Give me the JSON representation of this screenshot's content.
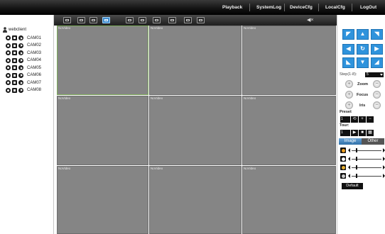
{
  "nav": {
    "items": [
      "Playback",
      "SystemLog",
      "DeviceCfg",
      "LocalCfg",
      "LogOut"
    ]
  },
  "sidebar": {
    "root_label": "webclient",
    "cameras": [
      "CAM01",
      "CAM02",
      "CAM03",
      "CAM04",
      "CAM05",
      "CAM06",
      "CAM07",
      "CAM08"
    ]
  },
  "toolbar": {
    "icons": [
      "fullscreen-icon",
      "layout-1-icon",
      "layout-4-icon",
      "layout-9-icon",
      "zoom-icon",
      "record-icon",
      "playback-icon",
      "snapshot-icon",
      "stream-icon",
      "settings-icon"
    ],
    "active_index": 3,
    "mute_symbol": "◀×"
  },
  "grid": {
    "no_video_label": "NoVideo"
  },
  "ptz": {
    "step_label": "Step(1-8):",
    "step_value": "5",
    "zoom_label": "Zoom",
    "focus_label": "Focus",
    "iris_label": "Iris",
    "preset_label": "Preset",
    "preset_value": "1",
    "tour_label": "Tour:",
    "tour_value": "1"
  },
  "image_panel": {
    "tabs": [
      "Image",
      "Other"
    ],
    "active_tab": 0,
    "sliders": [
      {
        "name": "brightness",
        "level": 0.15,
        "color": "#f0a020"
      },
      {
        "name": "contrast",
        "level": 0.15,
        "color": "#ffffff"
      },
      {
        "name": "saturation",
        "level": 0.15,
        "color": "#e8b030"
      },
      {
        "name": "hue",
        "level": 0.15,
        "color": "#cccccc"
      }
    ],
    "default_label": "Default"
  },
  "colors": {
    "accent": "#2f93dc",
    "video_bg": "#858585",
    "selected_border": "#7dab5a"
  }
}
